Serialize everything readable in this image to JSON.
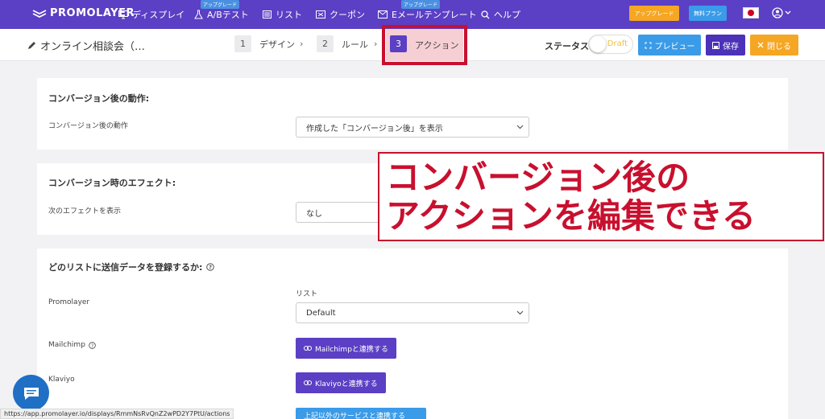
{
  "nav": {
    "logo": "PROMOLAYER",
    "items": [
      {
        "label": "ディスプレイ",
        "badge": ""
      },
      {
        "label": "A/Bテスト",
        "badge": "アップグレード"
      },
      {
        "label": "リスト",
        "badge": ""
      },
      {
        "label": "クーポン",
        "badge": ""
      },
      {
        "label": "Eメールテンプレート",
        "badge": "アップグレード"
      },
      {
        "label": "ヘルプ",
        "badge": ""
      }
    ],
    "upgrade_button": "アップグレード",
    "free_plan_button": "無料プラン"
  },
  "subbar": {
    "title": "オンライン相談会（…",
    "steps": [
      {
        "num": "1",
        "label": "デザイン"
      },
      {
        "num": "2",
        "label": "ルール"
      },
      {
        "num": "3",
        "label": "アクション"
      }
    ],
    "separator": "›",
    "status_label": "ステータス:",
    "status_toggle": "Draft",
    "preview_button": "プレビュー",
    "save_button": "保存",
    "close_button": "閉じる"
  },
  "sections": {
    "after_conversion": {
      "title": "コンバージョン後の動作:",
      "field_label": "コンバージョン後の動作",
      "field_value": "作成した「コンバージョン後」を表示"
    },
    "effect": {
      "title": "コンバージョン時のエフェクト:",
      "field_label": "次のエフェクトを表示",
      "field_value": "なし"
    },
    "lists": {
      "title": "どのリストに送信データを登録するか:",
      "list_label": "リスト",
      "rows": [
        {
          "name": "Promolayer",
          "value": "Default"
        },
        {
          "name": "Mailchimp",
          "button": "Mailchimpと連携する"
        },
        {
          "name": "Klaviyo",
          "button": "Klaviyoと連携する"
        }
      ],
      "other_button": "上記以外のサービスと連携する"
    }
  },
  "callout": {
    "line1": "コンバージョン後の",
    "line2": "アクションを編集できる"
  },
  "status_url": "https://app.promolayer.io/displays/RmmNsRvQnZ2wPD2Y7PtU/actions",
  "colors": {
    "nav_bg": "#5b3fc4",
    "accent_red": "#c8102e",
    "blue": "#3a9be8",
    "orange": "#f5a623"
  }
}
